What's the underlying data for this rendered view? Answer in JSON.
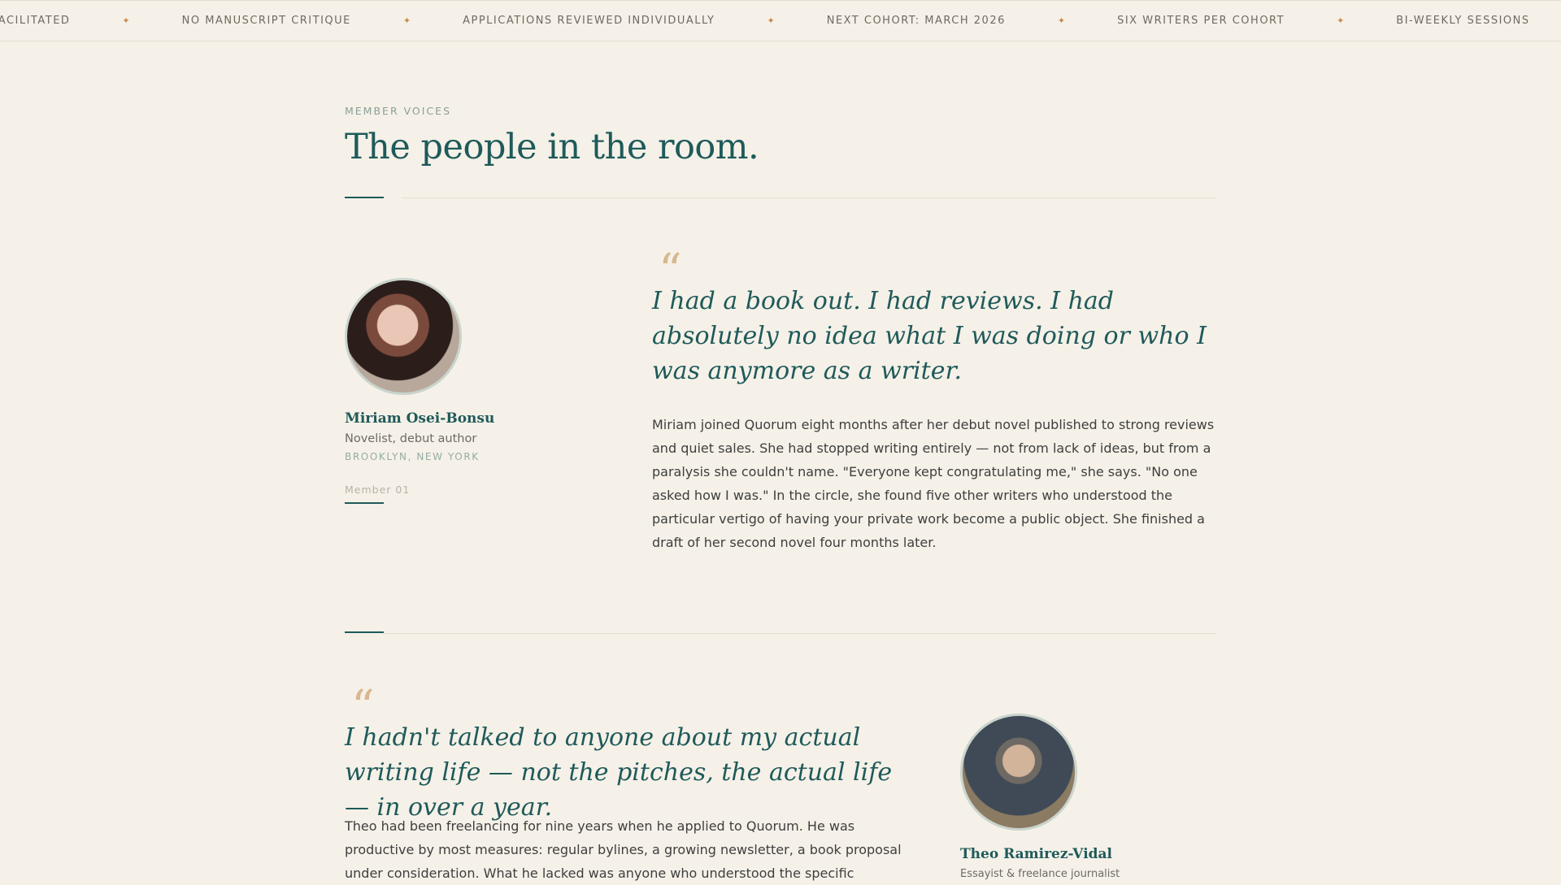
{
  "ticker": {
    "items": [
      "Facilitated",
      "No manuscript critique",
      "Applications reviewed individually",
      "Next cohort: March 2026",
      "Six writers per cohort",
      "Bi-weekly sessions"
    ],
    "separator": "✦"
  },
  "section": {
    "eyebrow": "Member Voices",
    "title": "The people in the room."
  },
  "members": [
    {
      "name": "Miriam Osei-Bonsu",
      "role": "Novelist, debut author",
      "location": "Brooklyn, New York",
      "number": "Member 01",
      "quote": "I had a book out. I had reviews. I had absolutely no idea what I was doing or who I was anymore as a writer.",
      "story": "Miriam joined Quorum eight months after her debut novel published to strong reviews and quiet sales. She had stopped writing entirely — not from lack of ideas, but from a paralysis she couldn't name. \"Everyone kept congratulating me,\" she says. \"No one asked how I was.\" In the circle, she found five other writers who understood the particular vertigo of having your private work become a public object. She finished a draft of her second novel four months later."
    },
    {
      "name": "Theo Ramirez-Vidal",
      "role": "Essayist & freelance journalist",
      "quote": "I hadn't talked to anyone about my actual writing life — not the pitches, the actual life — in over a year.",
      "story": "Theo had been freelancing for nine years when he applied to Quorum. He was productive by most measures: regular bylines, a growing newsletter, a book proposal under consideration. What he lacked was anyone who understood the specific"
    }
  ],
  "quote_mark": "“"
}
